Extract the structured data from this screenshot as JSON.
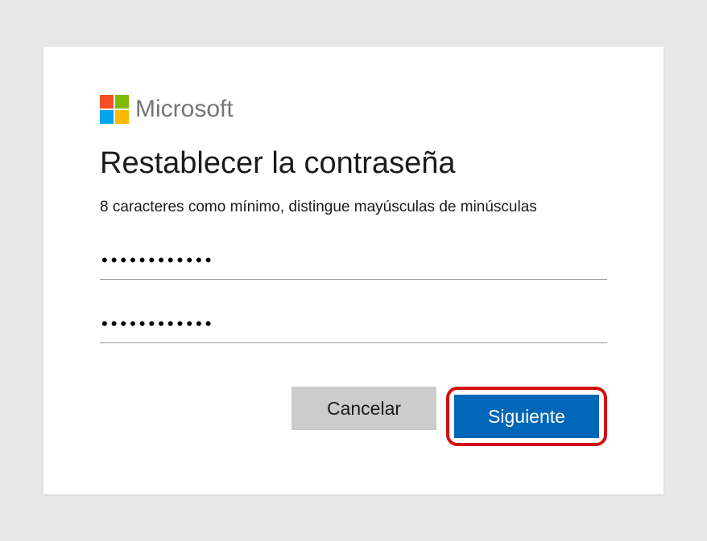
{
  "brand": {
    "name": "Microsoft",
    "logo_colors": {
      "tl": "#f25022",
      "tr": "#7fba00",
      "bl": "#00a4ef",
      "br": "#ffb900"
    }
  },
  "dialog": {
    "title": "Restablecer la contraseña",
    "subtitle": "8 caracteres como mínimo, distingue mayúsculas de minúsculas"
  },
  "inputs": {
    "password1_value": "●●●●●●●●●●●●",
    "password2_value": "●●●●●●●●●●●●"
  },
  "buttons": {
    "cancel_label": "Cancelar",
    "next_label": "Siguiente"
  }
}
